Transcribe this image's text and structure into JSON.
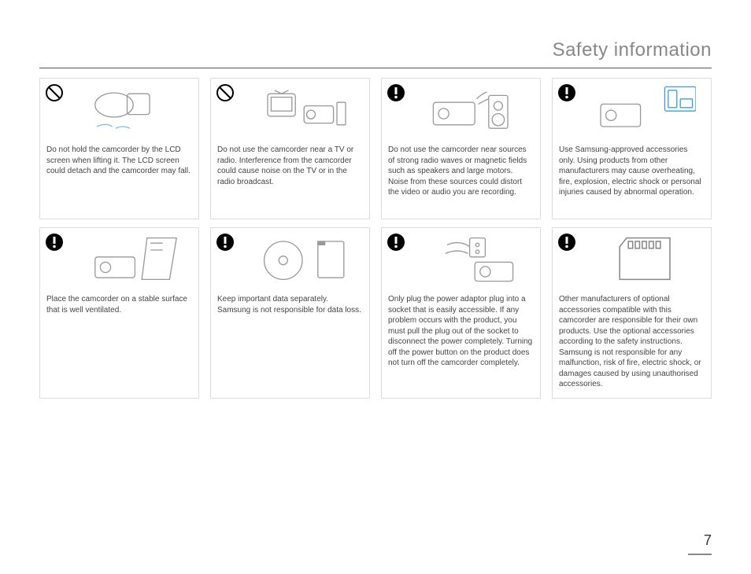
{
  "page_title": "Safety information",
  "page_number": "7",
  "icons": {
    "prohibit": "prohibit-icon",
    "caution": "caution-icon"
  },
  "cards": [
    {
      "icon": "prohibit",
      "text": "Do not hold the camcorder by the LCD screen when lifting it. The LCD screen could detach and the camcorder may fall."
    },
    {
      "icon": "prohibit",
      "text": "Do not use the camcorder near a TV or radio. Interference from the camcorder could cause noise on the TV or in the radio broadcast."
    },
    {
      "icon": "caution",
      "text": "Do not use the camcorder near sources of strong radio waves or magnetic fields such as speakers and large motors. Noise from these sources could distort the video or audio you are recording."
    },
    {
      "icon": "caution",
      "text": "Use Samsung-approved accessories only. Using products from other manufacturers may cause overheating, fire, explosion, electric shock or personal injuries caused by abnormal operation."
    },
    {
      "icon": "caution",
      "text": "Place the camcorder on a stable surface that is well ventilated."
    },
    {
      "icon": "caution",
      "text": "Keep important data separately. Samsung is not responsible for data loss."
    },
    {
      "icon": "caution",
      "text": "Only plug the power adaptor plug into a socket that is easily accessible. If any problem occurs with the product, you must pull the plug out of the socket to disconnect the power completely. Turning off the power button on the product does not turn off the camcorder completely."
    },
    {
      "icon": "caution",
      "text": "Other manufacturers of optional accessories compatible with this camcorder are responsible for their own products. Use the optional accessories according to the safety instructions. Samsung is not responsible for any malfunction, risk of fire, electric shock, or damages caused by using unauthorised accessories."
    }
  ]
}
